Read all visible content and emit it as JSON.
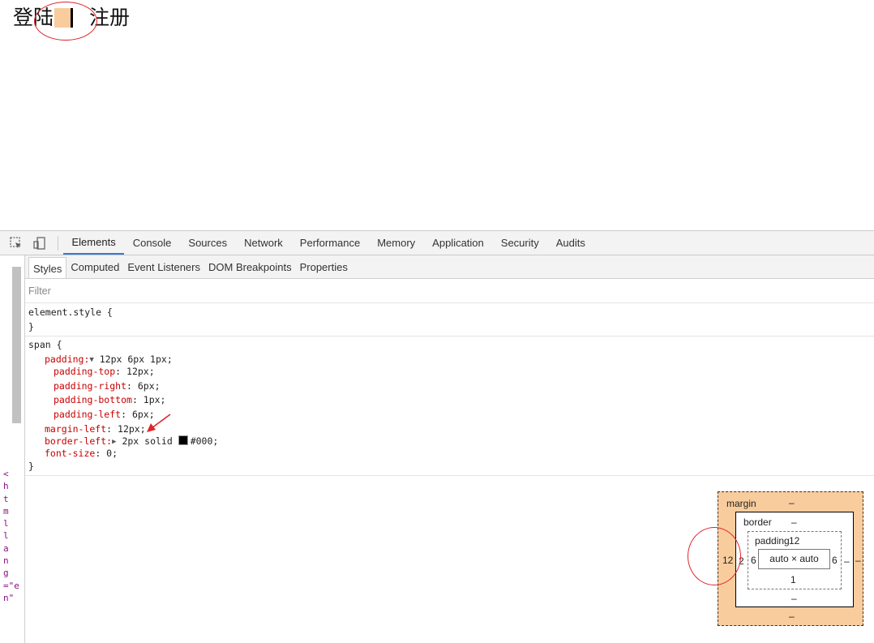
{
  "page": {
    "nav_login": "登陆",
    "nav_register": "注册"
  },
  "devtools": {
    "tabs": [
      "Elements",
      "Console",
      "Sources",
      "Network",
      "Performance",
      "Memory",
      "Application",
      "Security",
      "Audits"
    ],
    "active_tab": "Elements",
    "subtabs": [
      "Styles",
      "Computed",
      "Event Listeners",
      "DOM Breakpoints",
      "Properties"
    ],
    "active_subtab": "Styles",
    "filter_placeholder": "Filter",
    "dom_snippet": "<html lang=\"en\"",
    "element_style": {
      "open": "element.style {",
      "close": "}"
    },
    "rule": {
      "selector": "span {",
      "padding_name": "padding:",
      "padding_value": "12px 6px 1px;",
      "padding_top_name": "padding-top",
      "padding_top_value": ": 12px;",
      "padding_right_name": "padding-right",
      "padding_right_value": ": 6px;",
      "padding_bottom_name": "padding-bottom",
      "padding_bottom_value": ": 1px;",
      "padding_left_name": "padding-left",
      "padding_left_value": ": 6px;",
      "margin_left_name": "margin-left",
      "margin_left_value": ": 12px;",
      "border_left_name": "border-left:",
      "border_left_value_pre": "2px solid ",
      "border_left_color": "#000;",
      "font_size_name": "font-size",
      "font_size_value": ": 0;",
      "close": "}"
    },
    "box_model": {
      "margin_label": "margin",
      "margin_top": "–",
      "margin_left": "12",
      "margin_right": "–",
      "margin_bottom": "–",
      "border_label": "border",
      "border_top": "–",
      "border_left": "2",
      "border_right": "–",
      "border_bottom": "–",
      "padding_label": "padding",
      "padding_top": "12",
      "padding_left": "6",
      "padding_right": "6",
      "padding_bottom": "1",
      "content": "auto × auto"
    }
  },
  "colors": {
    "margin_fill": "#f9cc9d",
    "annotation": "#e0242b",
    "active_tab_underline": "#3879d9"
  }
}
